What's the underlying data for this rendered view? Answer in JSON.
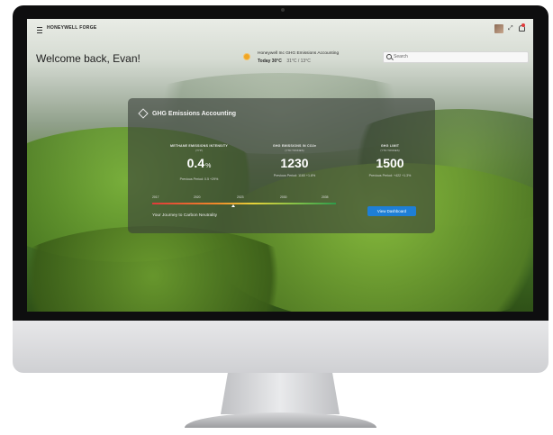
{
  "header": {
    "brand": "HONEYWELL FORGE"
  },
  "welcome": "Welcome back, Evan!",
  "weather": {
    "title": "Honeywell Inc GHG Emissions Accounting",
    "today_label": "Today",
    "temperature": "30°C",
    "range": "31°C / 13°C"
  },
  "search": {
    "placeholder": "Search"
  },
  "card": {
    "title": "GHG Emissions Accounting",
    "metrics": [
      {
        "label": "METHANE EMISSIONS INTENSITY",
        "unit": "(TYP)",
        "value": "0.4",
        "value_suffix": "%",
        "previous": "Previous Period: 0.5  +29%"
      },
      {
        "label": "GHG EMISSIONS IN CO2e",
        "unit": "(YTD TONNES)",
        "value": "1230",
        "previous": "Previous Period: 1160  +1.8%"
      },
      {
        "label": "GHG LIMIT",
        "unit": "(YTD TONNES)",
        "value": "1500",
        "previous": "Previous Period: +422  +1.3%"
      }
    ],
    "timeline": {
      "years": [
        "2017",
        "2020",
        "2023",
        "2030",
        "2035"
      ],
      "caption": "Your Journey to Carbon Neutrality"
    },
    "button": "View Dashboard"
  }
}
